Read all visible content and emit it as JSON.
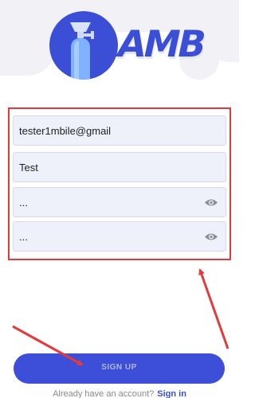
{
  "brand": {
    "logo_text": "AMB",
    "primary_color": "#3b4fd6"
  },
  "form": {
    "email": {
      "value": "tester1mbile@gmail"
    },
    "name": {
      "value": "Test"
    },
    "password": {
      "value": "...",
      "icon": "eye-icon"
    },
    "confirm_password": {
      "value": "...",
      "icon": "eye-icon"
    }
  },
  "actions": {
    "signup_label": "SIGN UP"
  },
  "footer": {
    "prompt": "Already have an account?",
    "signin_label": "Sign in"
  },
  "annotations": {
    "highlight_color": "#e23b3b"
  }
}
